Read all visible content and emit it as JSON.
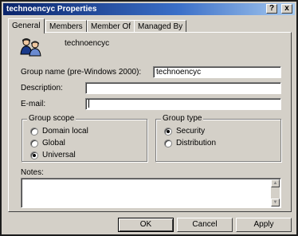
{
  "window": {
    "title": "technoencyc Properties",
    "help_label": "?",
    "close_label": "x"
  },
  "tabs": [
    {
      "label": "General",
      "active": true
    },
    {
      "label": "Members",
      "active": false
    },
    {
      "label": "Member Of",
      "active": false
    },
    {
      "label": "Managed By",
      "active": false
    }
  ],
  "general": {
    "group_display_name": "technoencyc",
    "group_icon": "group-users-icon",
    "fields": {
      "group_name_label": "Group name (pre-Windows 2000):",
      "group_name_value": "technoencyc",
      "description_label": "Description:",
      "description_value": "",
      "email_label": "E-mail:",
      "email_value": ""
    },
    "group_scope": {
      "title": "Group scope",
      "options": [
        {
          "label": "Domain local",
          "selected": false
        },
        {
          "label": "Global",
          "selected": false
        },
        {
          "label": "Universal",
          "selected": true
        }
      ]
    },
    "group_type": {
      "title": "Group type",
      "options": [
        {
          "label": "Security",
          "selected": true
        },
        {
          "label": "Distribution",
          "selected": false
        }
      ]
    },
    "notes_label": "Notes:",
    "notes_value": ""
  },
  "buttons": {
    "ok": "OK",
    "cancel": "Cancel",
    "apply": "Apply"
  }
}
